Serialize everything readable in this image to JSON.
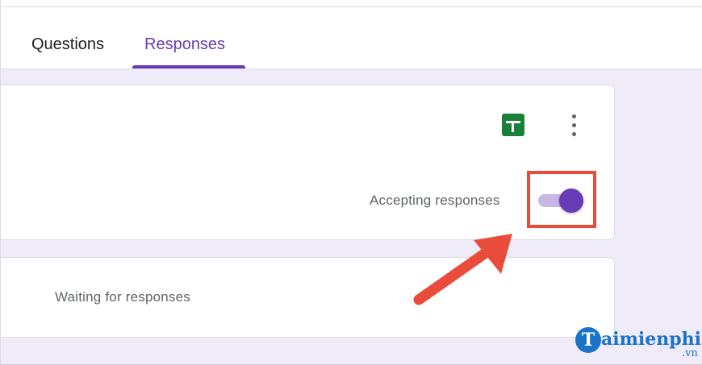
{
  "tabs": {
    "questions": "Questions",
    "responses": "Responses"
  },
  "summary_card": {
    "sheets_icon": "google-sheets-icon",
    "more_icon": "more-vert-icon",
    "accepting_label": "Accepting responses",
    "accepting_enabled": true
  },
  "waiting_card": {
    "text": "Waiting for responses"
  },
  "watermark": {
    "logo_letter": "T",
    "name": "aimienphi",
    "suffix": ".vn"
  },
  "colors": {
    "accent": "#673ab7",
    "background": "#f0ebf8",
    "highlight": "#ea4c3b",
    "sheets_green": "#188038"
  }
}
